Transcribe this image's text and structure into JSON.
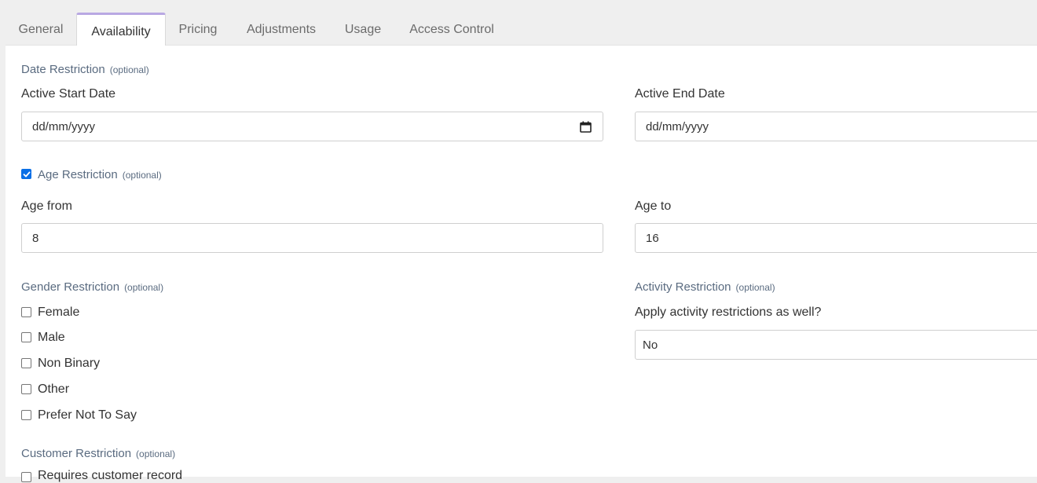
{
  "tabs": [
    {
      "label": "General"
    },
    {
      "label": "Availability"
    },
    {
      "label": "Pricing"
    },
    {
      "label": "Adjustments"
    },
    {
      "label": "Usage"
    },
    {
      "label": "Access Control"
    }
  ],
  "date_restriction": {
    "title": "Date Restriction",
    "optional": "(optional)",
    "start_label": "Active Start Date",
    "start_value": "dd/mm/yyyy",
    "end_label": "Active End Date",
    "end_value": "dd/mm/yyyy"
  },
  "age_restriction": {
    "title": "Age Restriction",
    "optional": "(optional)",
    "checked": true,
    "from_label": "Age from",
    "from_value": "8",
    "to_label": "Age to",
    "to_value": "16"
  },
  "gender_restriction": {
    "title": "Gender Restriction",
    "optional": "(optional)",
    "options": [
      {
        "label": "Female",
        "checked": false
      },
      {
        "label": "Male",
        "checked": false
      },
      {
        "label": "Non Binary",
        "checked": false
      },
      {
        "label": "Other",
        "checked": false
      },
      {
        "label": "Prefer Not To Say",
        "checked": false
      }
    ]
  },
  "activity_restriction": {
    "title": "Activity Restriction",
    "optional": "(optional)",
    "question": "Apply activity restrictions as well?",
    "selected": "No"
  },
  "customer_restriction": {
    "title": "Customer Restriction",
    "optional": "(optional)",
    "option_label": "Requires customer record",
    "option_checked": false
  },
  "colors": {
    "accent": "#b9a8e3",
    "checkbox_checked": "#0a6fe6",
    "section_label": "#5a6b80"
  }
}
